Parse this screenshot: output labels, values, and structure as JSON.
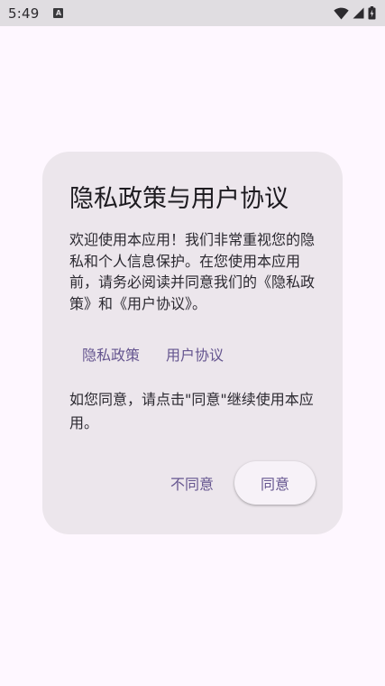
{
  "status_bar": {
    "time": "5:49",
    "app_icon_letter": "A",
    "icons": [
      "wifi-icon",
      "signal-icon",
      "battery-charging-icon"
    ]
  },
  "dialog": {
    "title": "隐私政策与用户协议",
    "body": "欢迎使用本应用！我们非常重视您的隐私和个人信息保护。在您使用本应用前，请务必阅读并同意我们的《隐私政策》和《用户协议》。",
    "links": [
      {
        "label": "隐私政策"
      },
      {
        "label": "用户协议"
      }
    ],
    "note": "如您同意，请点击\"同意\"继续使用本应用。",
    "disagree_label": "不同意",
    "agree_label": "同意"
  },
  "colors": {
    "background": "#FEF7FF",
    "dialog_surface": "#ECE6EC",
    "accent": "#65558F",
    "status_bar": "#E0DDE1"
  }
}
